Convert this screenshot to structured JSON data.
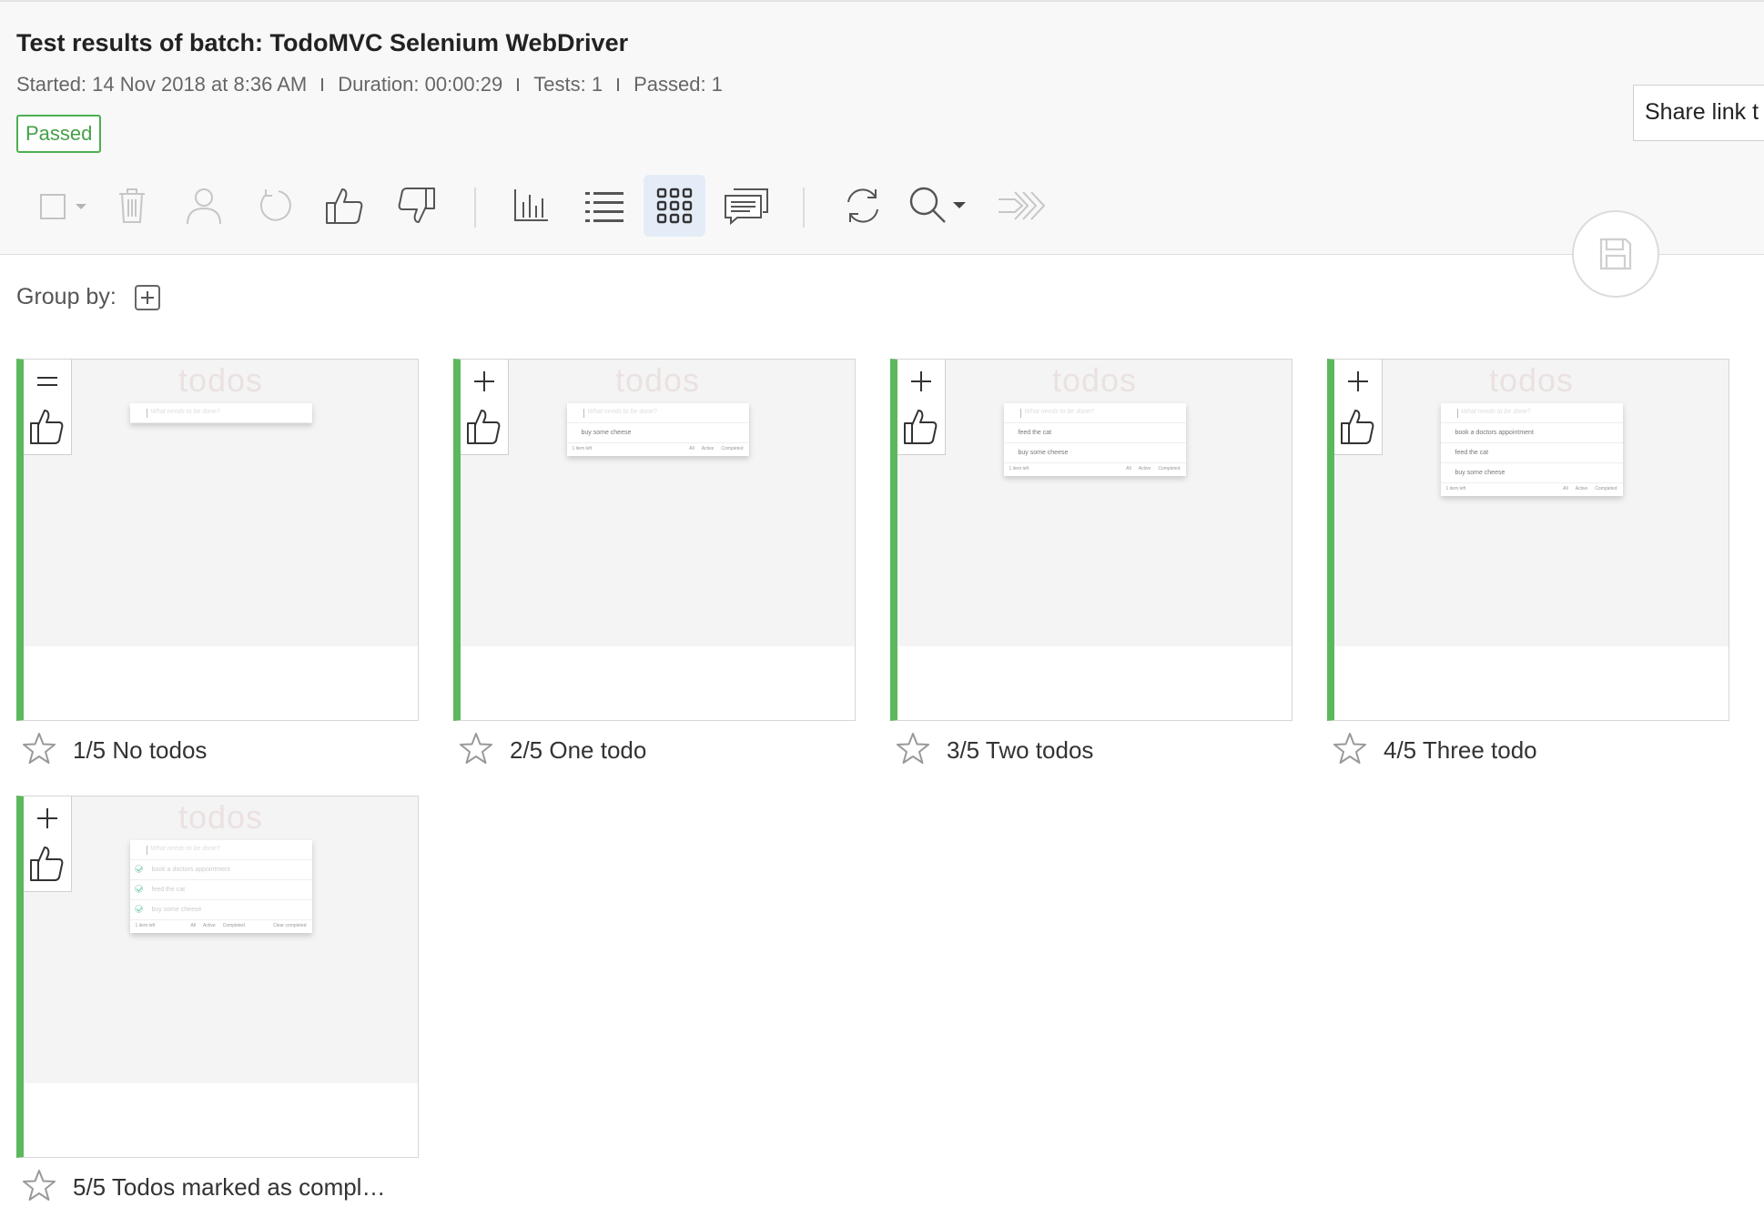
{
  "header": {
    "title": "Test results of batch: TodoMVC Selenium WebDriver",
    "meta": {
      "started": "Started: 14 Nov 2018 at 8:36 AM",
      "duration": "Duration: 00:00:29",
      "tests": "Tests: 1",
      "passed": "Passed: 1"
    },
    "status": "Passed",
    "share_link": "Share link t"
  },
  "toolbar": {
    "icons": [
      "select-checkbox-icon",
      "trash-icon",
      "user-icon",
      "undo-icon",
      "thumbs-up-icon",
      "thumbs-down-icon",
      "bar-chart-icon",
      "list-view-icon",
      "grid-view-icon",
      "comments-icon",
      "refresh-icon",
      "search-icon",
      "forward-arrows-icon",
      "save-icon"
    ],
    "active_view": "grid"
  },
  "group_by": {
    "label": "Group by:"
  },
  "thumb_watermark": "todos",
  "thumb_placeholder": "What needs to be done?",
  "thumb_footer": {
    "count": "1 item left",
    "all": "All",
    "active": "Active",
    "completed": "Completed",
    "clear": "Clear completed"
  },
  "cards": [
    {
      "label": "1/5 No todos",
      "overlay_sign": "=",
      "todos": [],
      "completed": false
    },
    {
      "label": "2/5 One todo",
      "overlay_sign": "+",
      "todos": [
        "buy some cheese"
      ],
      "completed": false
    },
    {
      "label": "3/5 Two todos",
      "overlay_sign": "+",
      "todos": [
        "feed the cat",
        "buy some cheese"
      ],
      "completed": false
    },
    {
      "label": "4/5 Three todo",
      "overlay_sign": "+",
      "todos": [
        "book a doctors appointment",
        "feed the cat",
        "buy some cheese"
      ],
      "completed": false
    },
    {
      "label": "5/5 Todos marked as compl…",
      "overlay_sign": "+",
      "todos": [
        "book a doctors appointment",
        "feed the cat",
        "buy some cheese"
      ],
      "completed": true
    }
  ],
  "colors": {
    "passed_green": "#5cb85c",
    "active_bg": "#e4edf7"
  }
}
